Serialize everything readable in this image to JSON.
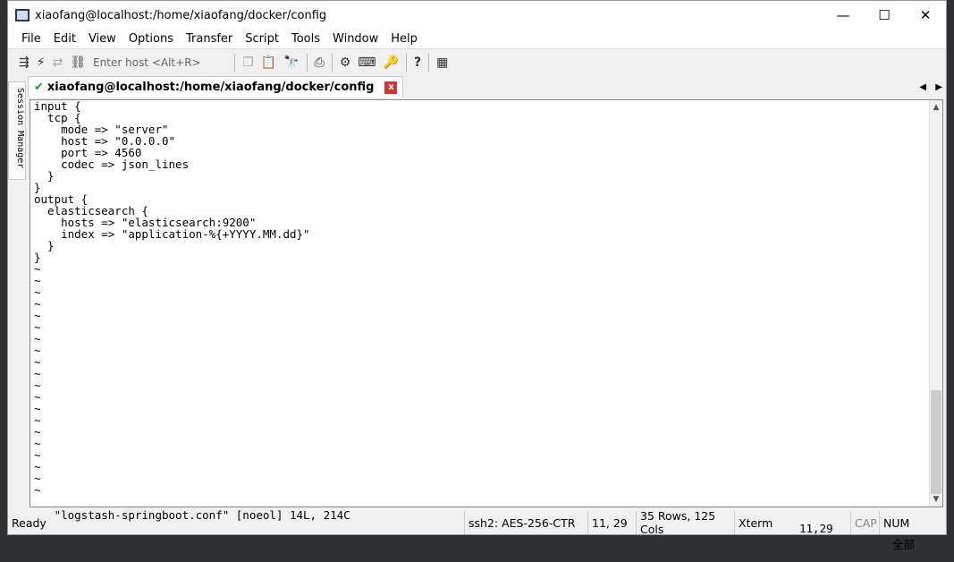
{
  "window": {
    "title": "xiaofang@localhost:/home/xiaofang/docker/config"
  },
  "menu": [
    "File",
    "Edit",
    "View",
    "Options",
    "Transfer",
    "Script",
    "Tools",
    "Window",
    "Help"
  ],
  "toolbar": {
    "host_placeholder": "Enter host <Alt+R>"
  },
  "tab": {
    "label": "xiaofang@localhost:/home/xiaofang/docker/config",
    "close": "x"
  },
  "session_manager": "Session Manager",
  "terminal": {
    "lines": [
      "input {",
      "  tcp {",
      "    mode => \"server\"",
      "    host => \"0.0.0.0\"",
      "    port => 4560",
      "    codec => json_lines",
      "  }",
      "}",
      "output {",
      "  elasticsearch {",
      "    hosts => \"elasticsearch:9200\"",
      "    index => \"application-%{+YYYY.MM.dd}\"",
      "  }",
      "}",
      "~",
      "~",
      "~",
      "~",
      "~",
      "~",
      "~",
      "~",
      "~",
      "~",
      "~",
      "~",
      "~",
      "~",
      "~",
      "~",
      "~",
      "~",
      "~",
      "~"
    ],
    "status_file": "\"logstash-springboot.conf\" [noeol] 14L, 214C",
    "status_pos": "11,29",
    "status_all": "全部"
  },
  "statusbar": {
    "ready": "Ready",
    "cipher": "ssh2: AES-256-CTR",
    "cursor": "11,  29",
    "size": "35 Rows, 125 Cols",
    "emulation": "Xterm",
    "cap": "CAP",
    "num": "NUM"
  }
}
